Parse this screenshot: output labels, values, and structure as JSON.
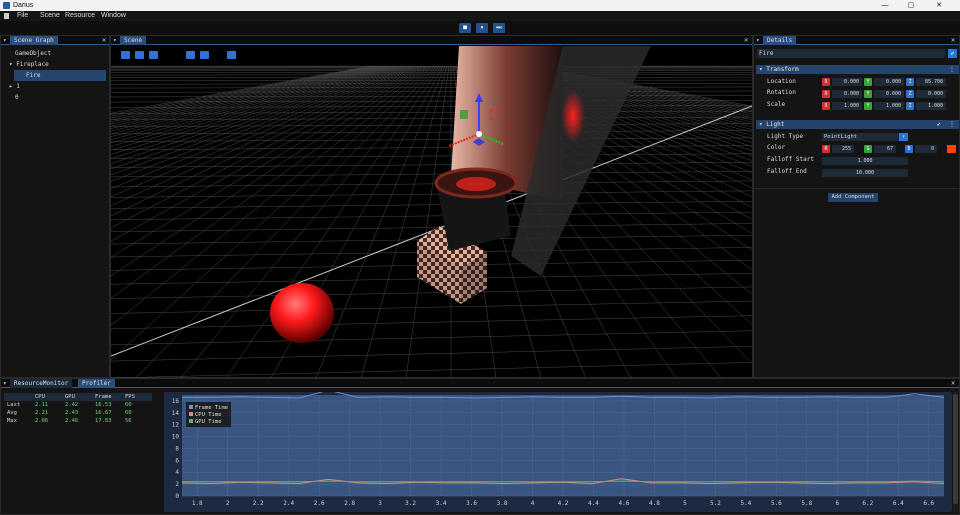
{
  "app": {
    "title": "Darius",
    "win_min": "—",
    "win_max": "▢",
    "win_close": "✕"
  },
  "menu": [
    "File",
    "Scene",
    "Resource",
    "Window"
  ],
  "playbar": {
    "stop": "■",
    "pause": "⏸",
    "step": "⏭"
  },
  "scene_graph": {
    "tab": "Scene Graph",
    "items": [
      {
        "label": "GameObject",
        "depth": 0,
        "arrow": ""
      },
      {
        "label": "Fireplace",
        "depth": 0,
        "arrow": "▾"
      },
      {
        "label": "Fire",
        "depth": 1,
        "arrow": "",
        "selected": true
      },
      {
        "label": "1",
        "depth": 0,
        "arrow": "▸"
      },
      {
        "label": "0",
        "depth": 0,
        "arrow": ""
      }
    ]
  },
  "scene": {
    "tab": "Scene",
    "tools": [
      "move-icon",
      "rotate-icon",
      "scale-icon",
      "globe-icon",
      "cube-icon",
      "grid-icon"
    ]
  },
  "details": {
    "tab": "Details",
    "name": "Fire",
    "transform": {
      "header": "Transform",
      "rows": [
        {
          "label": "Location",
          "x": "0.000",
          "y": "0.000",
          "z": "85.700"
        },
        {
          "label": "Rotation",
          "x": "0.000",
          "y": "0.000",
          "z": "0.000"
        },
        {
          "label": "Scale",
          "x": "1.000",
          "y": "1.000",
          "z": "1.000"
        }
      ]
    },
    "light": {
      "header": "Light",
      "type_label": "Light Type",
      "type_value": "PointLight",
      "color_label": "Color",
      "r": "255",
      "g": "67",
      "b": "0",
      "swatch": "#ff4300",
      "falloff_start_label": "Falloff Start",
      "falloff_start": "1.000",
      "falloff_end_label": "Falloff End",
      "falloff_end": "10.000"
    },
    "add_component": "Add Component"
  },
  "bottom": {
    "tabs": [
      "ResourceMonitor",
      "Profiler"
    ],
    "stats": {
      "headers": [
        "",
        "CPU",
        "GPU",
        "Frame",
        "FPS"
      ],
      "rows": [
        [
          "Last",
          "2.11",
          "2.42",
          "16.53",
          "60"
        ],
        [
          "Avg",
          "2.21",
          "2.43",
          "16.67",
          "60"
        ],
        [
          "Max",
          "2.86",
          "2.46",
          "17.83",
          "56"
        ]
      ]
    }
  },
  "chart_data": {
    "type": "line",
    "legend": [
      "Frame Time",
      "CPU Time",
      "GPU Time"
    ],
    "colors": {
      "frame": "#6f8fcf",
      "cpu": "#e08a7a",
      "gpu": "#5cb85c"
    },
    "ylim": [
      0,
      17
    ],
    "yticks": [
      "0",
      "2",
      "4",
      "6",
      "8",
      "10",
      "12",
      "14",
      "16"
    ],
    "xlim": [
      1.7,
      6.7
    ],
    "xticks": [
      "1.8",
      "2",
      "2.2",
      "2.4",
      "2.6",
      "2.8",
      "3",
      "3.2",
      "3.4",
      "3.6",
      "3.8",
      "4",
      "4.2",
      "4.4",
      "4.6",
      "4.8",
      "5",
      "5.2",
      "5.4",
      "5.6",
      "5.8",
      "6",
      "6.2",
      "6.4",
      "6.6"
    ],
    "series": [
      {
        "name": "Frame Time",
        "values": [
          16.6,
          16.6,
          16.7,
          16.6,
          16.5,
          17.8,
          16.6,
          16.7,
          16.6,
          16.6,
          16.5,
          16.6,
          16.7,
          16.6,
          16.6,
          16.8,
          16.6,
          16.6,
          16.5,
          16.7,
          16.6,
          16.6,
          16.7,
          16.6,
          16.6,
          17.2,
          16.6
        ]
      },
      {
        "name": "CPU Time",
        "values": [
          2.2,
          2.1,
          2.3,
          2.2,
          2.1,
          2.8,
          2.2,
          2.1,
          2.3,
          2.2,
          2.2,
          2.1,
          2.2,
          2.3,
          2.1,
          2.9,
          2.2,
          2.2,
          2.1,
          2.2,
          2.3,
          2.2,
          2.1,
          2.2,
          2.2,
          2.4,
          2.1
        ]
      },
      {
        "name": "GPU Time",
        "values": [
          2.4,
          2.4,
          2.4,
          2.4,
          2.4,
          2.5,
          2.4,
          2.4,
          2.4,
          2.4,
          2.4,
          2.4,
          2.4,
          2.4,
          2.4,
          2.5,
          2.4,
          2.4,
          2.4,
          2.4,
          2.4,
          2.4,
          2.4,
          2.4,
          2.4,
          2.5,
          2.4
        ]
      }
    ]
  }
}
